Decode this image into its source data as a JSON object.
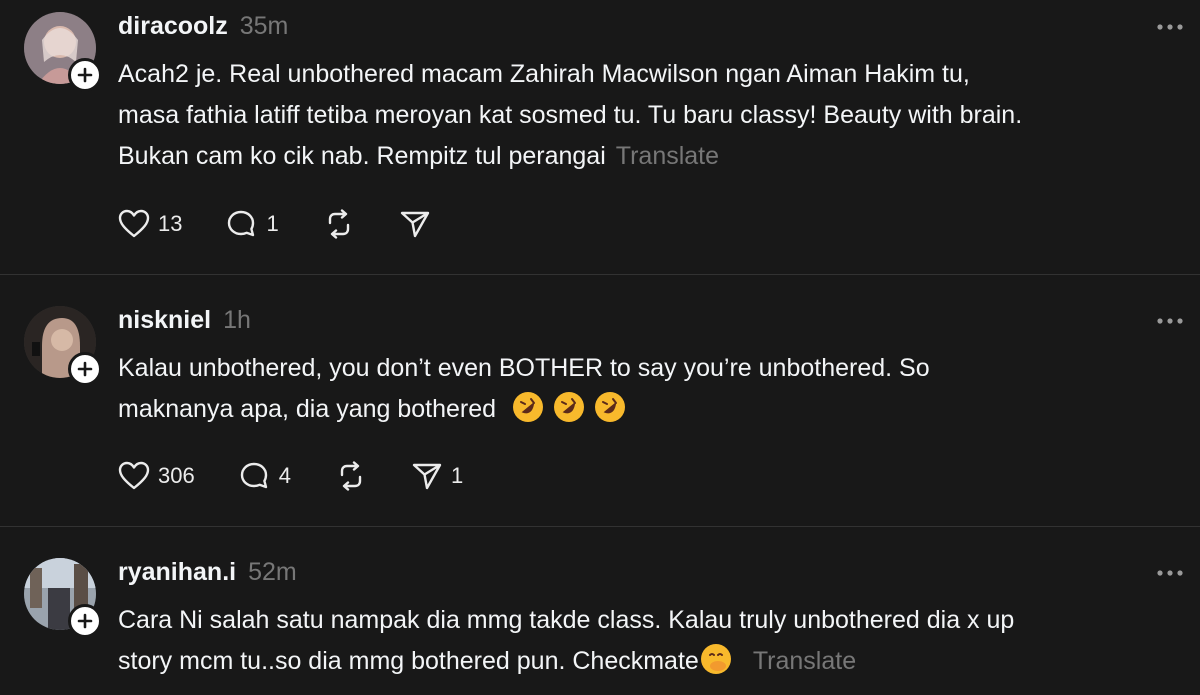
{
  "posts": [
    {
      "username": "diracoolz",
      "time": "35m",
      "lines": [
        "Acah2 je. Real unbothered macam Zahirah Macwilson ngan Aiman Hakim tu,",
        "masa fathia latiff tetiba meroyan kat sosmed tu. Tu baru classy! Beauty with brain.",
        "Bukan cam ko cik nab. Rempitz tul perangai"
      ],
      "translate": "Translate",
      "likes": "13",
      "replies": "1",
      "reposts": "",
      "shares": "",
      "avatar_colors": [
        "#c9a9a0",
        "#7a8cb0"
      ]
    },
    {
      "username": "niskniel",
      "time": "1h",
      "lines": [
        "Kalau unbothered, you don’t even BOTHER to say you’re unbothered. So",
        "maknanya apa, dia yang bothered"
      ],
      "emoji_count": 3,
      "emoji_name": "rolling-on-floor-laughing-emoji",
      "likes": "306",
      "replies": "4",
      "reposts": "",
      "shares": "1",
      "avatar_colors": [
        "#b99f8c",
        "#1c1c1c"
      ]
    },
    {
      "username": "ryanihan.i",
      "time": "52m",
      "lines": [
        "Cara Ni salah satu nampak dia mmg takde class. Kalau truly unbothered dia x up",
        "story mcm tu..so dia mmg bothered pun. Checkmate"
      ],
      "emoji_name": "face-with-hand-over-mouth-emoji",
      "translate": "Translate",
      "avatar_colors": [
        "#8b9bb0",
        "#4a3d35"
      ]
    }
  ],
  "icons": {
    "like": "heart-icon",
    "reply": "comment-icon",
    "repost": "repost-icon",
    "share": "send-icon",
    "more": "more-options-icon",
    "follow": "plus-icon"
  },
  "colors": {
    "background": "#181818",
    "text": "#f3f5f7",
    "muted": "#777777",
    "divider": "#323232"
  }
}
